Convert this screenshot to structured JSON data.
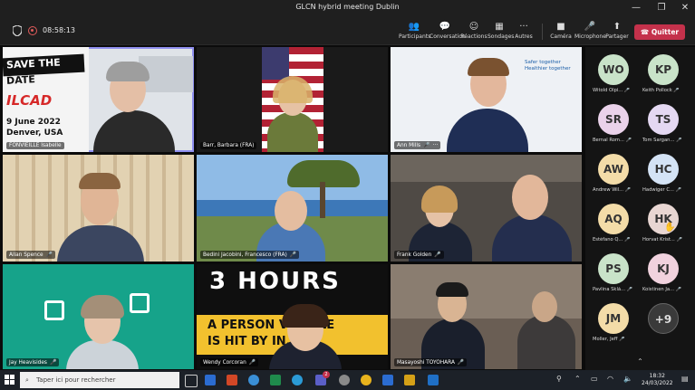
{
  "window": {
    "title": "GLCN hybrid meeting Dublin",
    "controls": [
      "—",
      "❐",
      "✕"
    ]
  },
  "toolbar": {
    "timer": "08:58:13",
    "participants": "Participants",
    "conversation": "Conversation",
    "reactions": "Réactions",
    "polls": "Sondages",
    "more": "Autres",
    "camera": "Caméra",
    "microphone": "Microphone",
    "share": "Partager",
    "leave": "Quitter",
    "leave_icon": "☎"
  },
  "tiles": [
    {
      "name": "FONVIEILLE Isabelle",
      "banner": [
        "SAVE THE",
        "DATE",
        "ILCAD",
        "9 June 2022",
        "Denver, USA"
      ]
    },
    {
      "name": "Barr, Barbara (FRA)"
    },
    {
      "name": "Ann Mills",
      "banner": [
        "Safer together",
        "Healthier together"
      ]
    },
    {
      "name": "Allan Spence"
    },
    {
      "name": "Bedini Jacobini, Francesco (FRA)"
    },
    {
      "name": "Frank Golden"
    },
    {
      "name": "Jay Heavisides"
    },
    {
      "name": "Wendy Corcoran",
      "banner": [
        "3 HOURS",
        "A PERSON VEHICLE",
        "IS HIT BY IN."
      ]
    },
    {
      "name": "Masayoshi TOYOHARA"
    }
  ],
  "roster": [
    {
      "initials": "WO",
      "name": "Witold Olpi...",
      "color": "#c9e3c9"
    },
    {
      "initials": "KP",
      "name": "Keith Pollock",
      "color": "#c9e3c9"
    },
    {
      "initials": "SR",
      "name": "Bernal Rom...",
      "color": "#ead2ea"
    },
    {
      "initials": "TS",
      "name": "Tom Sargan...",
      "color": "#e4d8f2"
    },
    {
      "initials": "AW",
      "name": "Andrew Wil...",
      "color": "#f3dca8"
    },
    {
      "initials": "HC",
      "name": "Hadwiger C...",
      "color": "#d4e3f5"
    },
    {
      "initials": "AQ",
      "name": "Estéfano Q...",
      "color": "#f3dca8"
    },
    {
      "initials": "HK",
      "name": "Horvat Krist...",
      "color": "#e8d6d2"
    },
    {
      "initials": "PS",
      "name": "Pavlina Sklá...",
      "color": "#c9e3c9"
    },
    {
      "initials": "KJ",
      "name": "Koistinen Ja...",
      "color": "#f1d2de"
    },
    {
      "initials": "JM",
      "name": "Moller, Jeff",
      "color": "#f3dca8"
    },
    {
      "initials": "+9",
      "name": "",
      "color": "#3a3a3a"
    }
  ],
  "taskbar": {
    "search_placeholder": "Taper ici pour rechercher",
    "time": "18:32",
    "date": "24/03/2022",
    "notification_count": "2"
  }
}
